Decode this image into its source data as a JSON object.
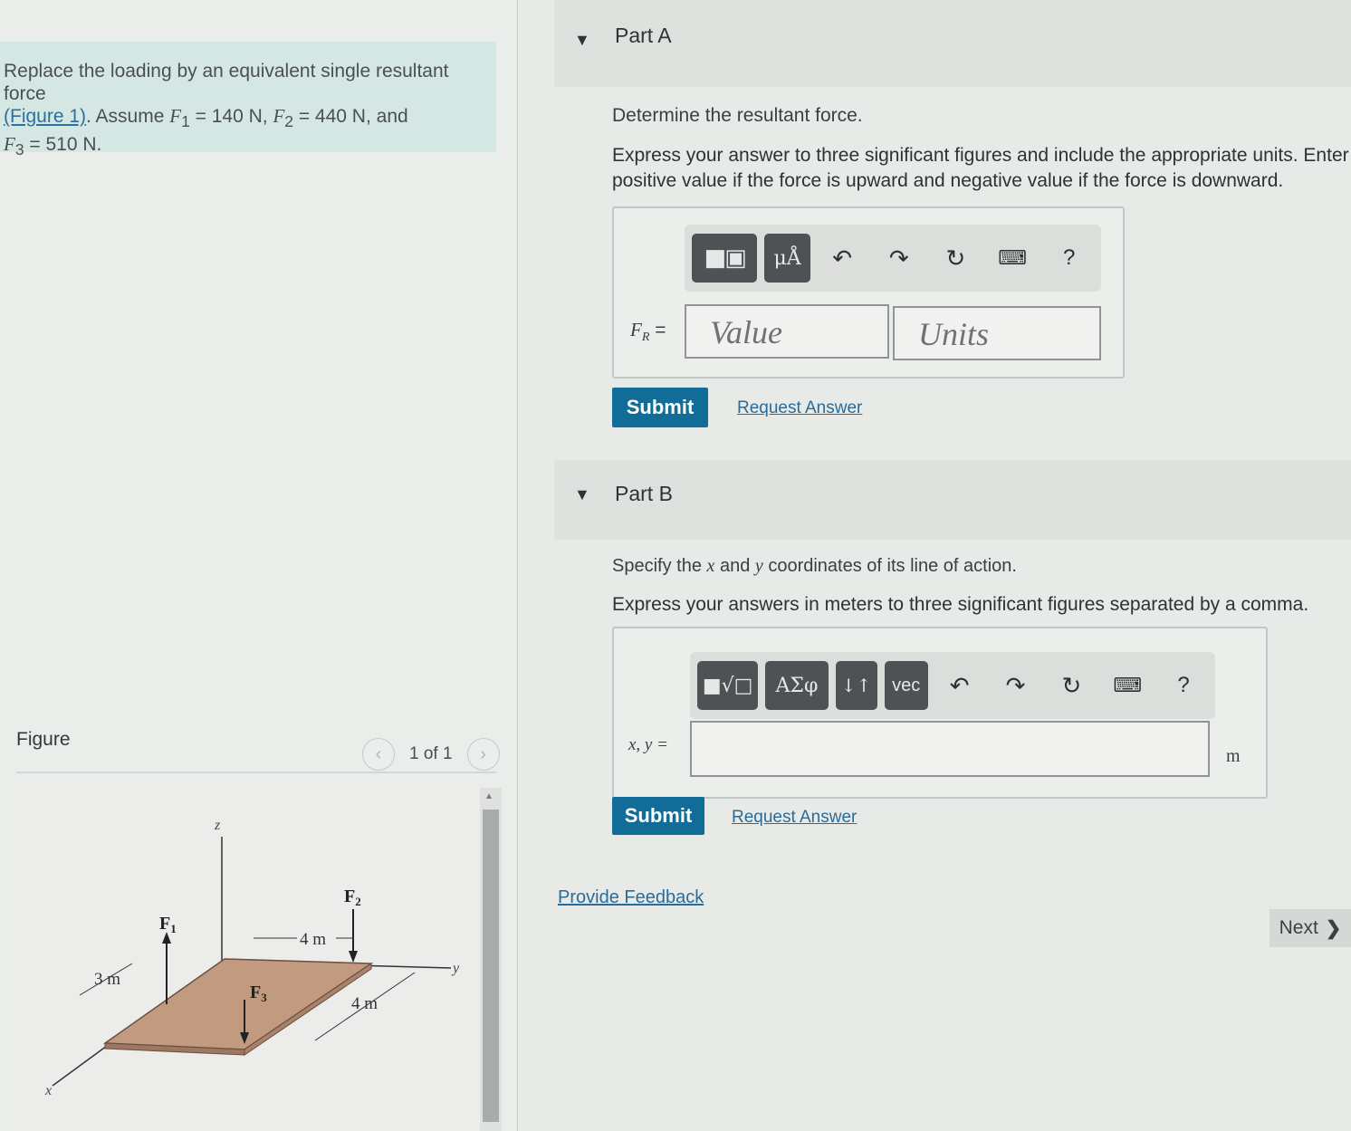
{
  "problem": {
    "line1": "Replace the loading by an equivalent single resultant force",
    "figure_link": "(Figure 1)",
    "assume": ". Assume ",
    "f1_sym": "F",
    "f1_sub": "1",
    "f1_val": " = 140 N, ",
    "f2_sym": "F",
    "f2_sub": "2",
    "f2_val": " = 440 N, and",
    "f3_sym": "F",
    "f3_sub": "3",
    "f3_val": " = 510 N."
  },
  "figure": {
    "header": "Figure",
    "count": "1 of 1",
    "labels": {
      "z": "z",
      "y": "y",
      "x": "x",
      "f1": "F",
      "f1_sub": "1",
      "f2": "F",
      "f2_sub": "2",
      "f3": "F",
      "f3_sub": "3",
      "dim_3m": "3 m",
      "dim_4m_top": "4 m",
      "dim_4m_right": "4 m"
    }
  },
  "partA": {
    "title": "Part A",
    "prompt": "Determine the resultant force.",
    "instruction": "Express your answer to three significant figures and include the appropriate units. Enter positive value if the force is upward and negative value if the force is downward.",
    "toolbar_mu": "μÅ",
    "help": "?",
    "label": "F",
    "label_sub": "R",
    "label_eq": " =",
    "value_placeholder": "Value",
    "units_placeholder": "Units",
    "submit": "Submit",
    "request": "Request Answer"
  },
  "partB": {
    "title": "Part B",
    "prompt_pre": "Specify the ",
    "x": "x",
    "prompt_mid": " and ",
    "y": "y",
    "prompt_post": " coordinates of its line of action.",
    "instruction": "Express your answers in meters to three significant figures separated by a comma.",
    "toolbar_greek": "ΑΣφ",
    "toolbar_arrows": "↓↑",
    "toolbar_vec": "vec",
    "help": "?",
    "label": "x, y =",
    "unit": "m",
    "submit": "Submit",
    "request": "Request Answer"
  },
  "feedback": "Provide Feedback",
  "next": "Next",
  "colors": {
    "submit": "#116d98",
    "link": "#2a6c99",
    "problem_bg": "#d5e7e3",
    "plate": "#c29a80"
  }
}
